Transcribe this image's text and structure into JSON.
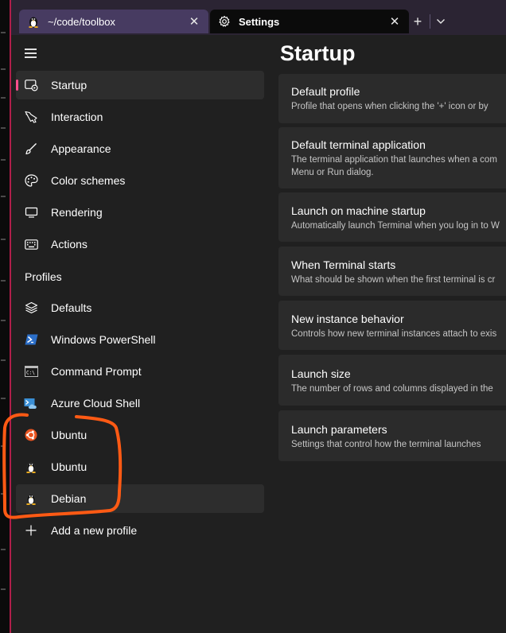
{
  "tabs": [
    {
      "title": "~/code/toolbox",
      "icon": "linux-penguin-icon",
      "active": false
    },
    {
      "title": "Settings",
      "icon": "gear-icon",
      "active": true
    }
  ],
  "new_tab_label": "+",
  "close_glyph": "✕",
  "sidebar": {
    "items": [
      {
        "label": "Startup",
        "icon": "startup-icon"
      },
      {
        "label": "Interaction",
        "icon": "pointer-icon"
      },
      {
        "label": "Appearance",
        "icon": "brush-icon"
      },
      {
        "label": "Color schemes",
        "icon": "palette-icon"
      },
      {
        "label": "Rendering",
        "icon": "monitor-icon"
      },
      {
        "label": "Actions",
        "icon": "keyboard-icon"
      }
    ],
    "profiles_header": "Profiles",
    "profiles": [
      {
        "label": "Defaults",
        "icon": "layers-icon"
      },
      {
        "label": "Windows PowerShell",
        "icon": "powershell-icon"
      },
      {
        "label": "Command Prompt",
        "icon": "cmd-icon"
      },
      {
        "label": "Azure Cloud Shell",
        "icon": "azure-cloud-shell-icon"
      },
      {
        "label": "Ubuntu",
        "icon": "ubuntu-icon"
      },
      {
        "label": "Ubuntu",
        "icon": "linux-penguin-icon"
      },
      {
        "label": "Debian",
        "icon": "linux-penguin-icon"
      }
    ],
    "add_profile_label": "Add a new profile"
  },
  "main": {
    "title": "Startup",
    "cards": [
      {
        "title": "Default profile",
        "description": "Profile that opens when clicking the '+' icon or by"
      },
      {
        "title": "Default terminal application",
        "description": "The terminal application that launches when a com Menu or Run dialog."
      },
      {
        "title": "Launch on machine startup",
        "description": "Automatically launch Terminal when you log in to W"
      },
      {
        "title": "When Terminal starts",
        "description": "What should be shown when the first terminal is cr"
      },
      {
        "title": "New instance behavior",
        "description": "Controls how new terminal instances attach to exis"
      },
      {
        "title": "Launch size",
        "description": "The number of rows and columns displayed in the"
      },
      {
        "title": "Launch parameters",
        "description": "Settings that control how the terminal launches"
      }
    ]
  },
  "colors": {
    "accent": "#ff4f8c",
    "annotation": "#ff5a14",
    "window_bg": "#202020",
    "card_bg": "#2b2b2b",
    "tab_inactive": "#473b61"
  }
}
